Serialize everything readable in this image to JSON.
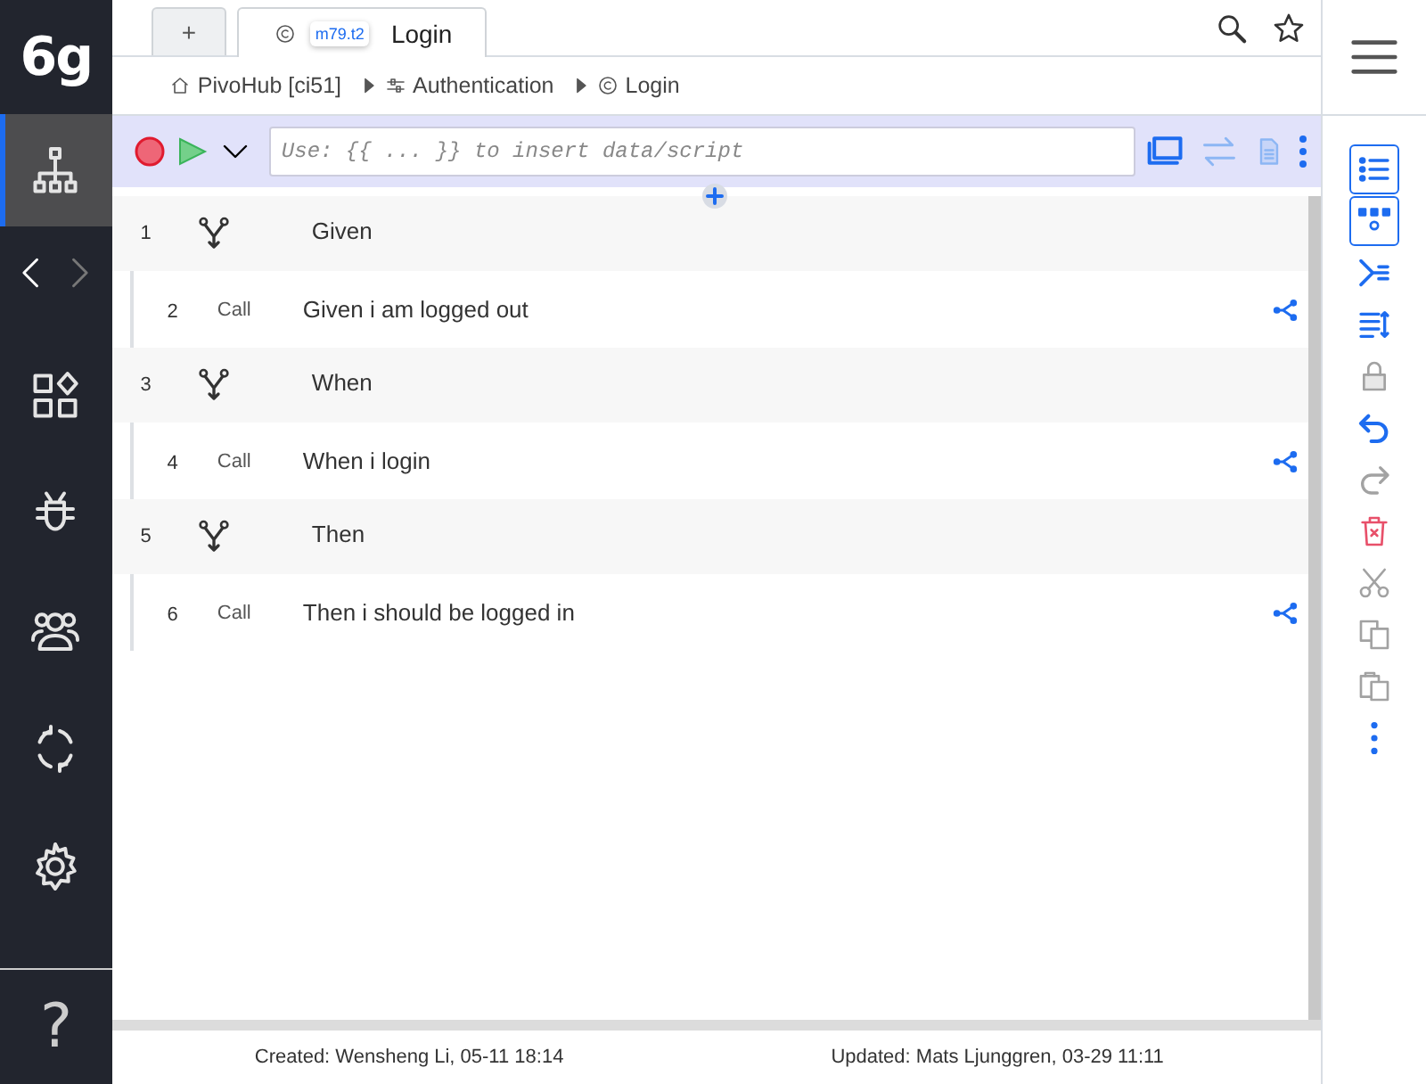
{
  "sidebar": {
    "logo": "6g",
    "items": [
      {
        "selected": true
      },
      {
        "selected": false
      },
      {
        "selected": false
      },
      {
        "selected": false
      },
      {
        "selected": false
      },
      {
        "selected": false
      }
    ],
    "history": {
      "back_disabled": false,
      "forward_disabled": true
    },
    "help": "?"
  },
  "tabs": [
    {
      "label": "+",
      "selected": false
    },
    {
      "label": "Login",
      "badge": "m79.t2",
      "selected": true
    }
  ],
  "breadcrumb": [
    "PivoHub [ci51]",
    "Authentication",
    "Login"
  ],
  "toolbar": {
    "placeholder": "Use: {{ ... }} to insert data/script"
  },
  "steps": [
    {
      "number": "1",
      "text": "Given",
      "children": [
        {
          "number": "2",
          "type": "Call",
          "text": "Given i am logged out"
        }
      ]
    },
    {
      "number": "3",
      "text": "When",
      "children": [
        {
          "number": "4",
          "type": "Call",
          "text": "When i login"
        }
      ]
    },
    {
      "number": "5",
      "text": "Then",
      "children": [
        {
          "number": "6",
          "type": "Call",
          "text": "Then i should be logged in"
        }
      ]
    }
  ],
  "footer": {
    "created": "Created: Wensheng Li, 05-11 18:14",
    "updated": "Updated: Mats Ljunggren, 03-29 11:11"
  },
  "tools": [
    {
      "selected": true,
      "disabled": false
    },
    {
      "selected": true,
      "disabled": false
    },
    {
      "selected": false,
      "disabled": false
    },
    {
      "selected": false,
      "disabled": false
    },
    {
      "selected": false,
      "disabled": true
    },
    {
      "selected": false,
      "disabled": false
    },
    {
      "selected": false,
      "disabled": true
    },
    {
      "selected": false,
      "disabled": false
    },
    {
      "selected": false,
      "disabled": true
    },
    {
      "selected": false,
      "disabled": true
    },
    {
      "selected": false,
      "disabled": true
    },
    {
      "selected": false,
      "disabled": false
    }
  ]
}
